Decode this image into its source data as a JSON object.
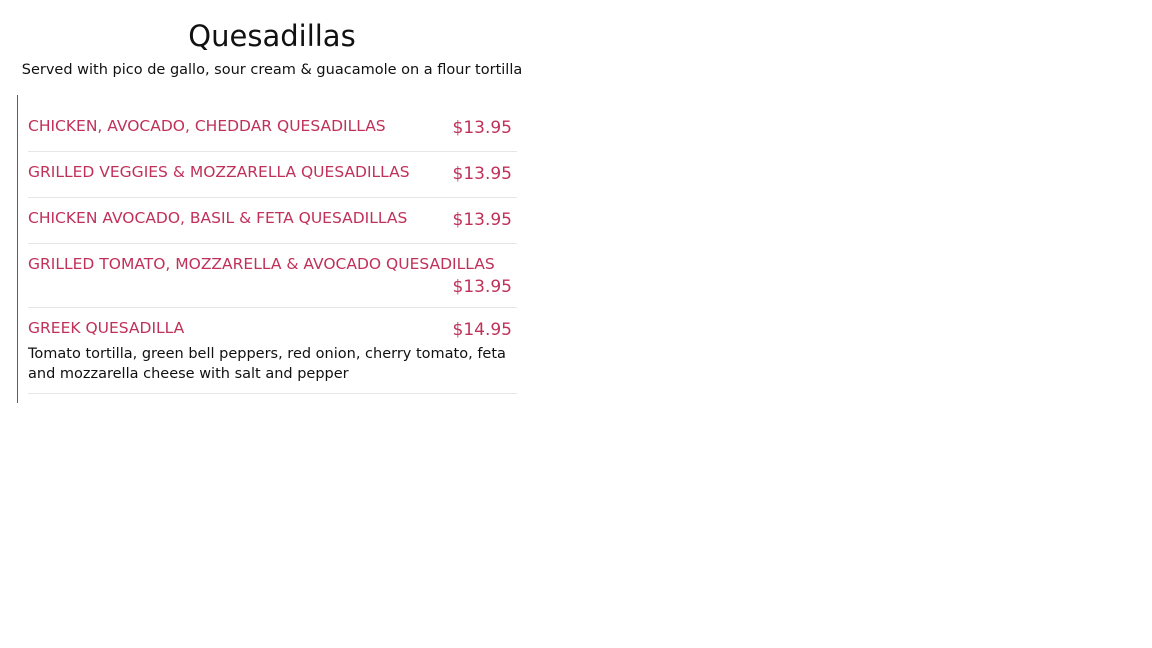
{
  "section": {
    "title": "Quesadillas",
    "subtitle": "Served with pico de gallo, sour cream & guacamole on a flour tortilla"
  },
  "items": [
    {
      "name": "CHICKEN, AVOCADO, CHEDDAR QUESADILLAS",
      "price": "$13.95"
    },
    {
      "name": "GRILLED VEGGIES & MOZZARELLA QUESADILLAS",
      "price": "$13.95"
    },
    {
      "name": "CHICKEN AVOCADO, BASIL & FETA QUESADILLAS",
      "price": "$13.95"
    },
    {
      "name": "GRILLED TOMATO, MOZZARELLA & AVOCADO QUESADILLAS",
      "price": "$13.95"
    },
    {
      "name": "GREEK QUESADILLA",
      "price": "$14.95",
      "description": "Tomato tortilla, green bell peppers, red onion, cherry tomato, feta and mozzarella cheese with salt and pepper"
    }
  ],
  "colors": {
    "accent": "#c0315a",
    "divider": "#e6e6e6",
    "text": "#111111"
  }
}
